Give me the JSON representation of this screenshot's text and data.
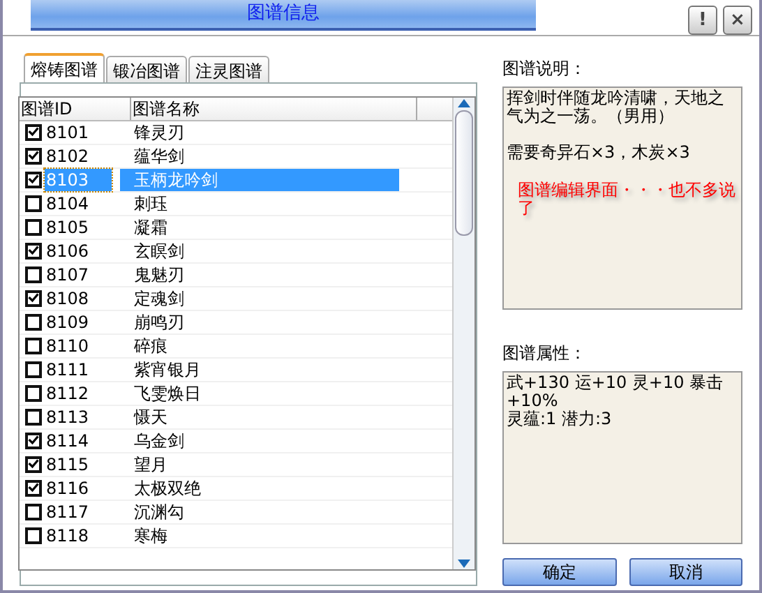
{
  "window": {
    "title": "图谱信息",
    "buttons": [
      "!",
      "×"
    ]
  },
  "tabs": [
    {
      "label": "熔铸图谱",
      "selected": true
    },
    {
      "label": "锻冶图谱",
      "selected": false
    },
    {
      "label": "注灵图谱",
      "selected": false
    }
  ],
  "table": {
    "columns": [
      "图谱ID",
      "图谱名称"
    ],
    "rows": [
      {
        "id": "8101",
        "name": "锋灵刃",
        "checked": true,
        "selected": false
      },
      {
        "id": "8102",
        "name": "蕴华剑",
        "checked": true,
        "selected": false
      },
      {
        "id": "8103",
        "name": "玉柄龙吟剑",
        "checked": true,
        "selected": true
      },
      {
        "id": "8104",
        "name": "刺珏",
        "checked": false,
        "selected": false
      },
      {
        "id": "8105",
        "name": "凝霜",
        "checked": false,
        "selected": false
      },
      {
        "id": "8106",
        "name": "玄瞑剑",
        "checked": true,
        "selected": false
      },
      {
        "id": "8107",
        "name": "鬼魅刃",
        "checked": false,
        "selected": false
      },
      {
        "id": "8108",
        "name": "定魂剑",
        "checked": true,
        "selected": false
      },
      {
        "id": "8109",
        "name": "崩鸣刃",
        "checked": false,
        "selected": false
      },
      {
        "id": "8110",
        "name": "碎痕",
        "checked": false,
        "selected": false
      },
      {
        "id": "8111",
        "name": "紫宵银月",
        "checked": false,
        "selected": false
      },
      {
        "id": "8112",
        "name": "飞雯焕日",
        "checked": false,
        "selected": false
      },
      {
        "id": "8113",
        "name": "慑天",
        "checked": false,
        "selected": false
      },
      {
        "id": "8114",
        "name": "乌金剑",
        "checked": true,
        "selected": false
      },
      {
        "id": "8115",
        "name": "望月",
        "checked": true,
        "selected": false
      },
      {
        "id": "8116",
        "name": "太极双绝",
        "checked": true,
        "selected": false
      },
      {
        "id": "8117",
        "name": "沉渊勾",
        "checked": false,
        "selected": false
      },
      {
        "id": "8118",
        "name": "寒梅",
        "checked": false,
        "selected": false
      }
    ]
  },
  "description": {
    "label": "图谱说明：",
    "lines": [
      "挥剑时伴随龙吟清啸，天地之气为之一荡。（男用）",
      "需要奇异石×3，木炭×3"
    ],
    "note": "图谱编辑界面・・・也不多说了"
  },
  "attributes": {
    "label": "图谱属性：",
    "lines": [
      "武+130 运+10 灵+10 暴击+10%",
      "灵蕴:1 潜力:3"
    ]
  },
  "buttons": [
    "确定",
    "取消"
  ]
}
